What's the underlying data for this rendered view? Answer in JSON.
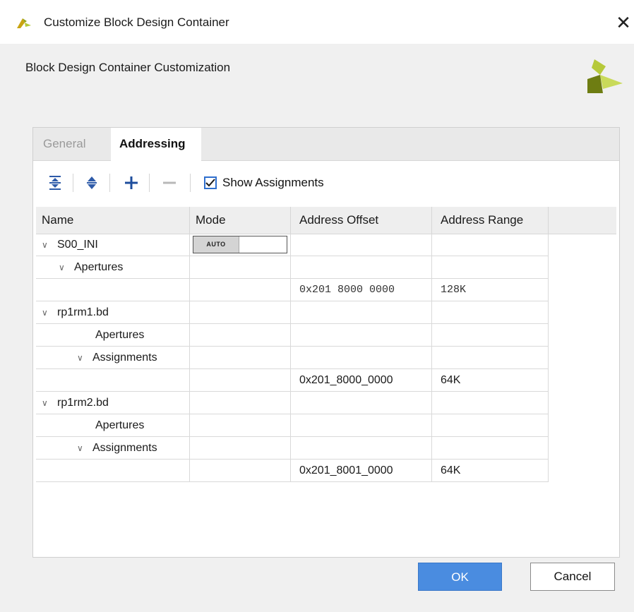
{
  "window": {
    "title": "Customize Block Design Container",
    "close_glyph": "✕"
  },
  "header": {
    "subtitle": "Block Design Container Customization"
  },
  "tabs": [
    {
      "label": "General",
      "active": false
    },
    {
      "label": "Addressing",
      "active": true
    }
  ],
  "toolbar": {
    "icons": [
      "collapse-all-icon",
      "expand-all-icon",
      "plus-icon",
      "minus-icon"
    ],
    "show_assignments_label": "Show Assignments",
    "show_assignments_checked": true
  },
  "table": {
    "columns": [
      "Name",
      "Mode",
      "Address Offset",
      "Address Range"
    ],
    "rows": [
      {
        "name": "S00_INI",
        "chevron": "∨",
        "mode": "AUTO",
        "offset": "",
        "range": ""
      },
      {
        "name": "Apertures",
        "chevron": "∨",
        "mode": "",
        "offset": "",
        "range": ""
      },
      {
        "name": "",
        "chevron": "",
        "mode": "",
        "offset": "0x201 8000 0000",
        "range": "128K"
      },
      {
        "name": "rp1rm1.bd",
        "chevron": "∨",
        "mode": "",
        "offset": "",
        "range": ""
      },
      {
        "name": "Apertures",
        "chevron": "",
        "mode": "",
        "offset": "",
        "range": ""
      },
      {
        "name": "Assignments",
        "chevron": "∨",
        "mode": "",
        "offset": "",
        "range": ""
      },
      {
        "name": "",
        "chevron": "",
        "mode": "",
        "offset": "0x201_8000_0000",
        "range": "64K"
      },
      {
        "name": "rp1rm2.bd",
        "chevron": "∨",
        "mode": "",
        "offset": "",
        "range": ""
      },
      {
        "name": "Apertures",
        "chevron": "",
        "mode": "",
        "offset": "",
        "range": ""
      },
      {
        "name": "Assignments",
        "chevron": "∨",
        "mode": "",
        "offset": "",
        "range": ""
      },
      {
        "name": "",
        "chevron": "",
        "mode": "",
        "offset": "0x201_8001_0000",
        "range": "64K"
      }
    ]
  },
  "buttons": {
    "ok": "OK",
    "cancel": "Cancel"
  },
  "colors": {
    "accent": "#4a8ce0",
    "checkbox": "#2f6fce",
    "logo_light": "#b6c93a",
    "logo_dark": "#6e7d12"
  }
}
